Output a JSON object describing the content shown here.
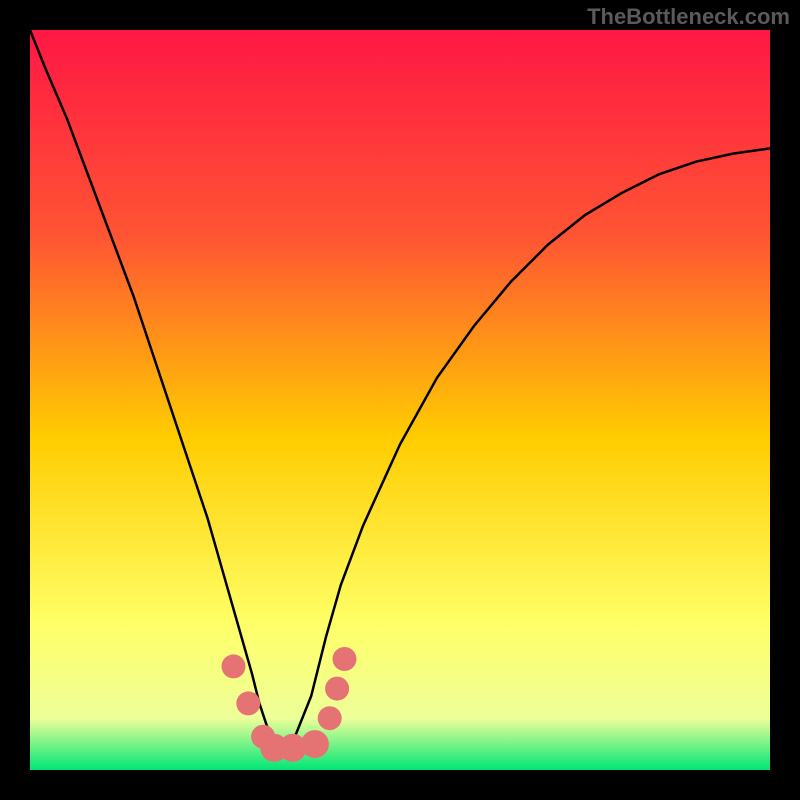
{
  "watermark": "TheBottleneck.com",
  "chart_data": {
    "type": "line",
    "title": "",
    "xlabel": "",
    "ylabel": "",
    "xlim": [
      0,
      100
    ],
    "ylim": [
      0,
      100
    ],
    "gradient_background": {
      "top": "#ff1744",
      "upper_mid": "#ff5533",
      "mid": "#ffcc00",
      "lower_mid": "#ffff66",
      "bottom": "#00e676"
    },
    "series": [
      {
        "name": "bottleneck-curve",
        "x": [
          0,
          2,
          5,
          8,
          11,
          14,
          17,
          20,
          22,
          24,
          26,
          28,
          30,
          31,
          32,
          33,
          34,
          35,
          36,
          38,
          40,
          42,
          45,
          50,
          55,
          60,
          65,
          70,
          75,
          80,
          85,
          90,
          95,
          100
        ],
        "y": [
          100,
          95,
          88,
          80,
          72,
          64,
          55,
          46,
          40,
          34,
          27,
          20,
          13,
          9,
          6,
          4,
          3,
          3,
          5,
          10,
          18,
          25,
          33,
          44,
          53,
          60,
          66,
          71,
          75,
          78,
          80.5,
          82.2,
          83.3,
          84
        ],
        "color": "#000000"
      }
    ],
    "markers": [
      {
        "x": 27.5,
        "y": 14,
        "r": 12,
        "color": "#e57373"
      },
      {
        "x": 29.5,
        "y": 9,
        "r": 12,
        "color": "#e57373"
      },
      {
        "x": 31.5,
        "y": 4.5,
        "r": 12,
        "color": "#e57373"
      },
      {
        "x": 33.0,
        "y": 3,
        "r": 14,
        "color": "#e57373"
      },
      {
        "x": 35.5,
        "y": 3,
        "r": 14,
        "color": "#e57373"
      },
      {
        "x": 38.5,
        "y": 3.5,
        "r": 14,
        "color": "#e57373"
      },
      {
        "x": 40.5,
        "y": 7,
        "r": 12,
        "color": "#e57373"
      },
      {
        "x": 41.5,
        "y": 11,
        "r": 12,
        "color": "#e57373"
      },
      {
        "x": 42.5,
        "y": 15,
        "r": 12,
        "color": "#e57373"
      }
    ]
  }
}
